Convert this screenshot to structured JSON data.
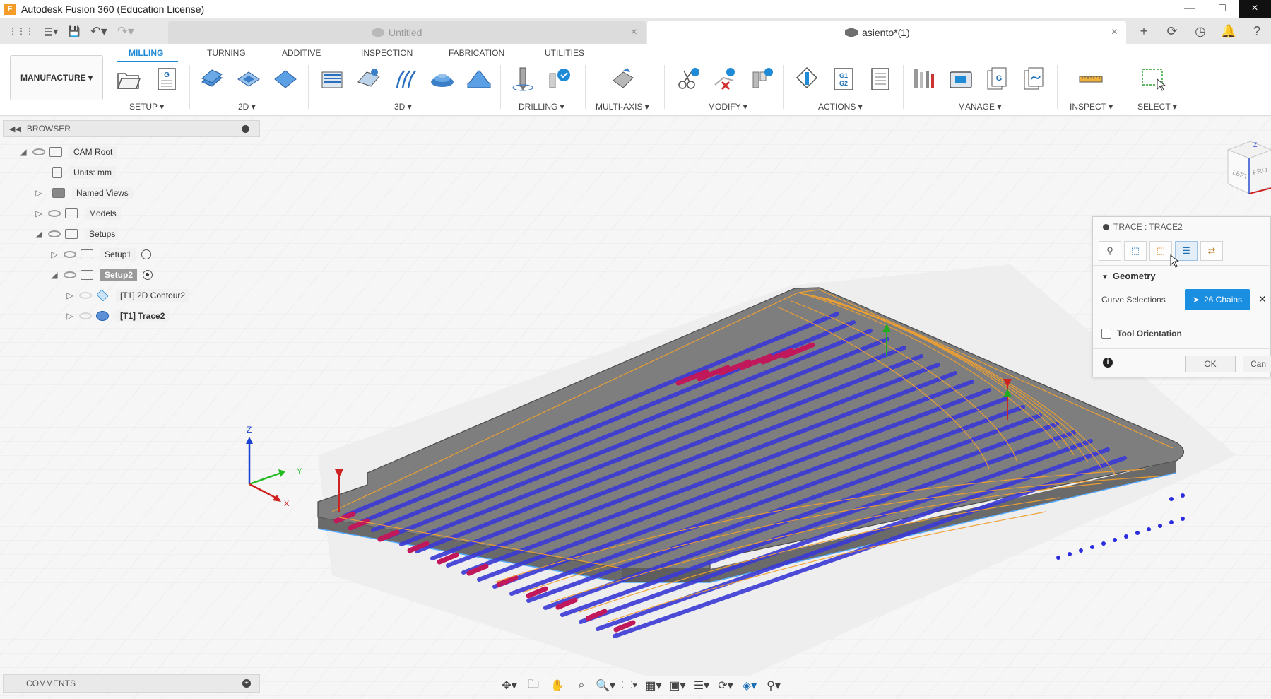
{
  "window": {
    "title": "Autodesk Fusion 360 (Education License)",
    "app_logo_letter": "F",
    "minimize_icon": "—",
    "maximize_icon": "□"
  },
  "tabs": [
    {
      "label": "Untitled",
      "active": false
    },
    {
      "label": "asiento*(1)",
      "active": true
    }
  ],
  "tab_close_glyph": "×",
  "quick_access": {
    "grid_icon": "⋮⋮⋮",
    "file_icon": "▤▾",
    "save_icon": "💾",
    "undo_icon": "↶▾",
    "redo_icon": "↷▾"
  },
  "tab_right_icons": [
    "+",
    "⟳",
    "◷",
    "🔔",
    "?"
  ],
  "workspace": {
    "label": "MANUFACTURE ▾"
  },
  "ribbon_tabs": [
    "MILLING",
    "TURNING",
    "ADDITIVE",
    "INSPECTION",
    "FABRICATION",
    "UTILITIES"
  ],
  "ribbon_groups": [
    "SETUP ▾",
    "2D ▾",
    "3D ▾",
    "DRILLING ▾",
    "MULTI-AXIS ▾",
    "MODIFY ▾",
    "ACTIONS ▾",
    "MANAGE ▾",
    "INSPECT ▾",
    "SELECT ▾"
  ],
  "actions_icon_text": "G1\nG2",
  "setup_icon_text": "G",
  "browser": {
    "title": "BROWSER",
    "items": [
      {
        "label": "CAM Root"
      },
      {
        "label": "Units: mm"
      },
      {
        "label": "Named Views"
      },
      {
        "label": "Models"
      },
      {
        "label": "Setups"
      },
      {
        "label": "Setup1"
      },
      {
        "label": "Setup2"
      },
      {
        "label": "[T1] 2D Contour2"
      },
      {
        "label": "[T1] Trace2"
      }
    ]
  },
  "dialog": {
    "title": "TRACE : TRACE2",
    "section": "Geometry",
    "curve_label": "Curve Selections",
    "curve_value": "26 Chains",
    "tool_orientation": "Tool Orientation",
    "ok": "OK",
    "cancel": "Can",
    "clear": "✕",
    "info": "i"
  },
  "comments": {
    "label": "COMMENTS",
    "add": "+"
  },
  "axis": {
    "z": "Z",
    "y": "Y",
    "x": "X"
  },
  "viewcube": {
    "top": "Z",
    "left": "LEFT",
    "front": "FRO"
  },
  "nav_icons": [
    "✥▾",
    "🗀",
    "✋",
    "⌕",
    "🔍▾",
    "🖵▾",
    "▦▾",
    "▣▾",
    "☰▾",
    "⟳▾",
    "◈▾",
    "⚲▾"
  ],
  "colors": {
    "accent": "#1f8ad6",
    "toolpath_blue": "#3a3ad6",
    "rapid_orange": "#f0a030",
    "plunge_red": "#c0185a",
    "stock_gray": "#7e7e7e"
  }
}
